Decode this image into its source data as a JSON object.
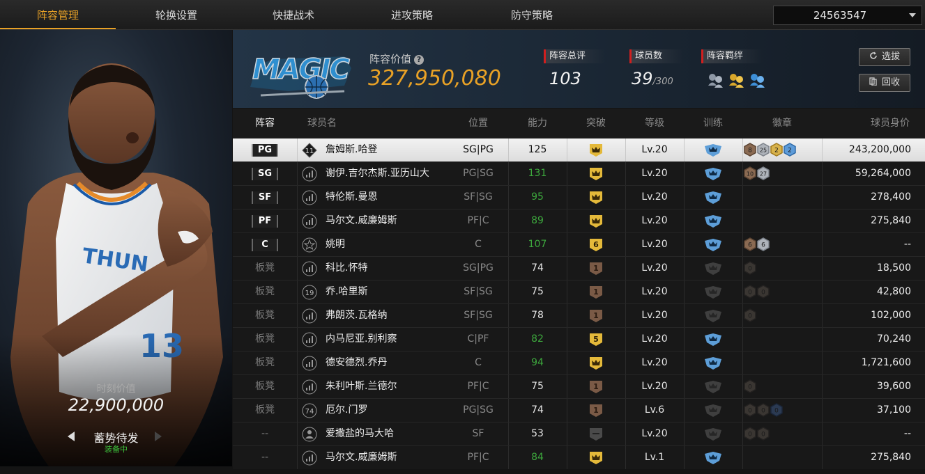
{
  "tabs": [
    "阵容管理",
    "轮换设置",
    "快捷战术",
    "进攻策略",
    "防守策略"
  ],
  "account_select": {
    "value": "24563547"
  },
  "left_panel": {
    "moment_value_label": "时刻价值",
    "moment_value": "22,900,000",
    "state_label": "蓄势待发",
    "state_sub": "装备中"
  },
  "header": {
    "team_value_label": "阵容价值",
    "team_value": "327,950,080",
    "overall_label": "阵容总评",
    "overall_value": "103",
    "players_label": "球员数",
    "players_value": "39",
    "players_max": "/300",
    "bond_label": "阵容羁绊",
    "bond_icons": [
      "bond-silver-icon",
      "bond-gold-icon",
      "bond-blue-icon"
    ],
    "btn_draft": "选拔",
    "btn_recycle": "回收"
  },
  "columns": [
    "阵容",
    "球员名",
    "位置",
    "能力",
    "突破",
    "等级",
    "训练",
    "徽章",
    "球员身价"
  ],
  "colors": {
    "accent": "#e8a126",
    "green": "#3da83d",
    "red": "#d11f1f"
  },
  "rows": [
    {
      "slot": "PG",
      "starter": true,
      "num_icon": "11",
      "name": "詹姆斯.哈登",
      "pos": "SG|PG",
      "ability": "125",
      "ability_color": "white",
      "break": "crown-gold",
      "break_text": "",
      "level": "Lv.20",
      "train": "blue",
      "badges": [
        {
          "t": "8",
          "c": "bronze"
        },
        {
          "t": "25",
          "c": "silver"
        },
        {
          "t": "2",
          "c": "gold"
        },
        {
          "t": "2",
          "c": "blue"
        }
      ],
      "value": "243,200,000",
      "selected": true
    },
    {
      "slot": "SG",
      "starter": true,
      "num_icon": "bars",
      "name": "谢伊.吉尔杰斯.亚历山大",
      "pos": "PG|SG",
      "ability": "131",
      "ability_color": "green",
      "break": "crown-gold",
      "break_text": "",
      "level": "Lv.20",
      "train": "blue",
      "badges": [
        {
          "t": "10",
          "c": "bronze"
        },
        {
          "t": "27",
          "c": "silver"
        }
      ],
      "value": "59,264,000"
    },
    {
      "slot": "SF",
      "starter": true,
      "num_icon": "bars",
      "name": "特伦斯.曼恩",
      "pos": "SF|SG",
      "ability": "95",
      "ability_color": "green",
      "break": "crown-gold",
      "break_text": "",
      "level": "Lv.20",
      "train": "blue",
      "badges": [],
      "value": "278,400"
    },
    {
      "slot": "PF",
      "starter": true,
      "num_icon": "bars",
      "name": "马尔文.威廉姆斯",
      "pos": "PF|C",
      "ability": "89",
      "ability_color": "green",
      "break": "crown-gold",
      "break_text": "",
      "level": "Lv.20",
      "train": "blue",
      "badges": [],
      "value": "275,840"
    },
    {
      "slot": "C",
      "starter": true,
      "num_icon": "star",
      "name": "姚明",
      "pos": "C",
      "ability": "107",
      "ability_color": "green",
      "break": "num-gold",
      "break_text": "6",
      "level": "Lv.20",
      "train": "blue",
      "badges": [
        {
          "t": "6",
          "c": "bronze"
        },
        {
          "t": "6",
          "c": "silver"
        }
      ],
      "value": "--"
    },
    {
      "slot": "板凳",
      "starter": false,
      "num_icon": "bars",
      "name": "科比.怀特",
      "pos": "SG|PG",
      "ability": "74",
      "ability_color": "white",
      "break": "num-brown",
      "break_text": "1",
      "level": "Lv.20",
      "train": "grey",
      "badges": [
        {
          "t": "0",
          "c": "dark"
        }
      ],
      "value": "18,500"
    },
    {
      "slot": "板凳",
      "starter": false,
      "num_icon": "19",
      "name": "乔.哈里斯",
      "pos": "SF|SG",
      "ability": "75",
      "ability_color": "white",
      "break": "num-brown",
      "break_text": "1",
      "level": "Lv.20",
      "train": "grey",
      "badges": [
        {
          "t": "0",
          "c": "dark"
        },
        {
          "t": "0",
          "c": "dark"
        }
      ],
      "value": "42,800"
    },
    {
      "slot": "板凳",
      "starter": false,
      "num_icon": "bars",
      "name": "弗朗茨.瓦格纳",
      "pos": "SF|SG",
      "ability": "78",
      "ability_color": "white",
      "break": "num-brown",
      "break_text": "1",
      "level": "Lv.20",
      "train": "grey",
      "badges": [
        {
          "t": "0",
          "c": "dark"
        }
      ],
      "value": "102,000"
    },
    {
      "slot": "板凳",
      "starter": false,
      "num_icon": "bars",
      "name": "内马尼亚.别利察",
      "pos": "C|PF",
      "ability": "82",
      "ability_color": "green",
      "break": "num-gold",
      "break_text": "5",
      "level": "Lv.20",
      "train": "blue",
      "badges": [],
      "value": "70,240"
    },
    {
      "slot": "板凳",
      "starter": false,
      "num_icon": "bars",
      "name": "德安德烈.乔丹",
      "pos": "C",
      "ability": "94",
      "ability_color": "green",
      "break": "crown-gold",
      "break_text": "",
      "level": "Lv.20",
      "train": "blue",
      "badges": [],
      "value": "1,721,600"
    },
    {
      "slot": "板凳",
      "starter": false,
      "num_icon": "bars",
      "name": "朱利叶斯.兰德尔",
      "pos": "PF|C",
      "ability": "75",
      "ability_color": "white",
      "break": "num-brown",
      "break_text": "1",
      "level": "Lv.20",
      "train": "grey",
      "badges": [
        {
          "t": "0",
          "c": "dark"
        }
      ],
      "value": "39,600"
    },
    {
      "slot": "板凳",
      "starter": false,
      "num_icon": "74",
      "name": "厄尔.门罗",
      "pos": "PG|SG",
      "ability": "74",
      "ability_color": "white",
      "break": "num-brown",
      "break_text": "1",
      "level": "Lv.6",
      "train": "grey",
      "badges": [
        {
          "t": "0",
          "c": "dark"
        },
        {
          "t": "0",
          "c": "dark"
        },
        {
          "t": "0",
          "c": "darkblue"
        }
      ],
      "value": "37,100"
    },
    {
      "slot": "--",
      "starter": false,
      "num_icon": "person",
      "name": "爱撒盐的马大哈",
      "pos": "SF",
      "ability": "53",
      "ability_color": "white",
      "break": "grey",
      "break_text": "",
      "level": "Lv.20",
      "train": "grey",
      "badges": [
        {
          "t": "0",
          "c": "dark"
        },
        {
          "t": "0",
          "c": "dark"
        }
      ],
      "value": "--"
    },
    {
      "slot": "--",
      "starter": false,
      "num_icon": "bars",
      "name": "马尔文.威廉姆斯",
      "pos": "PF|C",
      "ability": "84",
      "ability_color": "green",
      "break": "crown-gold",
      "break_text": "",
      "level": "Lv.1",
      "train": "blue",
      "badges": [],
      "value": "275,840"
    }
  ]
}
